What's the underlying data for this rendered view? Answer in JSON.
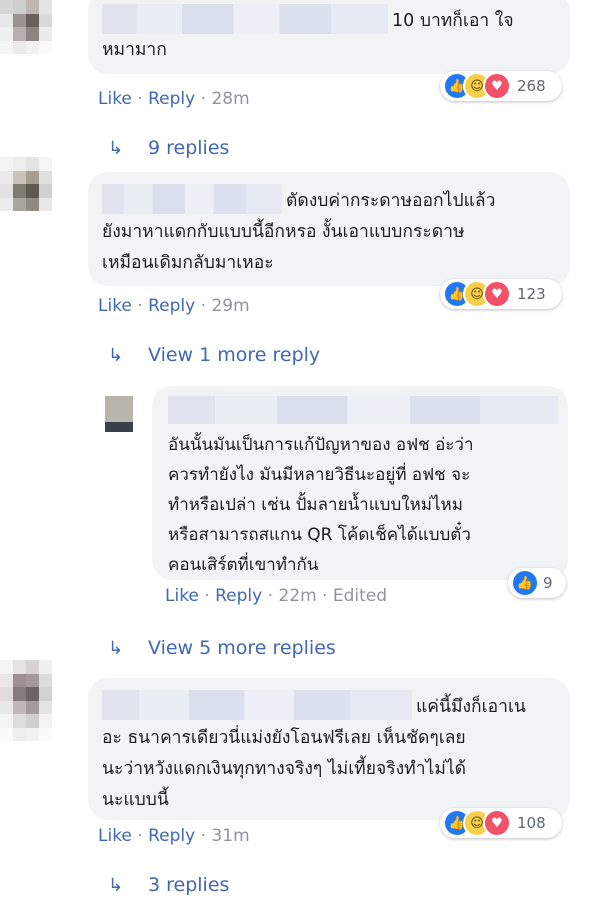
{
  "comments": [
    {
      "text": "10 บาทก็เอา ใจหมามาก",
      "line1": "10 บาทก็เอา ใจ",
      "line2": "หมามาก",
      "actions": {
        "like": "Like",
        "reply": "Reply",
        "time": "28m"
      },
      "reactions": {
        "count": "268",
        "types": [
          "like-icon",
          "haha-icon",
          "love-icon"
        ]
      },
      "replies_link": "9 replies"
    },
    {
      "line1": "ตัดงบค่ากระดาษออกไปแล้ว",
      "line2": "ยังมาหาแดกกับแบบนี้อีกหรอ งั้นเอาแบบกระดาษ",
      "line3": "เหมือนเดิมกลับมาเหอะ",
      "actions": {
        "like": "Like",
        "reply": "Reply",
        "time": "29m"
      },
      "reactions": {
        "count": "123",
        "types": [
          "like-icon",
          "haha-icon",
          "love-icon"
        ]
      },
      "replies_link": "View 1 more reply"
    },
    {
      "line1": "แค่นี้มึงก็เอาเน",
      "line2": "อะ ธนาคารเดียวนี่แม่งยังโอนฟรีเลย เห็นชัดๆเลย",
      "line3": "นะว่าหวังแดกเงินทุกทางจริงๆ ไม่เที้ยจริงทำไม่ได้",
      "line4": "นะแบบนี้",
      "actions": {
        "like": "Like",
        "reply": "Reply",
        "time": "31m"
      },
      "reactions": {
        "count": "108",
        "types": [
          "like-icon",
          "haha-icon",
          "love-icon"
        ]
      },
      "replies_link": "3 replies"
    }
  ],
  "nested_reply": {
    "line1": "อันนั้นมันเป็นการแก้ปัญหาของ อฟช อ่ะว่า",
    "line2": "ควรทำยังไง มันมีหลายวิธีนะอยู่ที่ อฟช จะ",
    "line3": "ทำหรือเปล่า เช่น ปั้มลายน้ำแบบใหม่ไหม",
    "line4": "หรือสามารถสแกน QR โค้ดเช็คได้แบบตั๋ว",
    "line5": "คอนเสิร์ตที่เขาทำกัน",
    "actions": {
      "like": "Like",
      "reply": "Reply",
      "time": "22m",
      "edited": "Edited"
    },
    "reactions": {
      "count": "9",
      "types": [
        "like-icon"
      ]
    }
  },
  "more_replies_link": "View 5 more replies",
  "colors": {
    "link": "#4267b2",
    "meta": "#90949c",
    "bubble": "#f2f3f5",
    "like": "#2078f4",
    "love": "#f25268",
    "haha": "#f7d04b"
  }
}
